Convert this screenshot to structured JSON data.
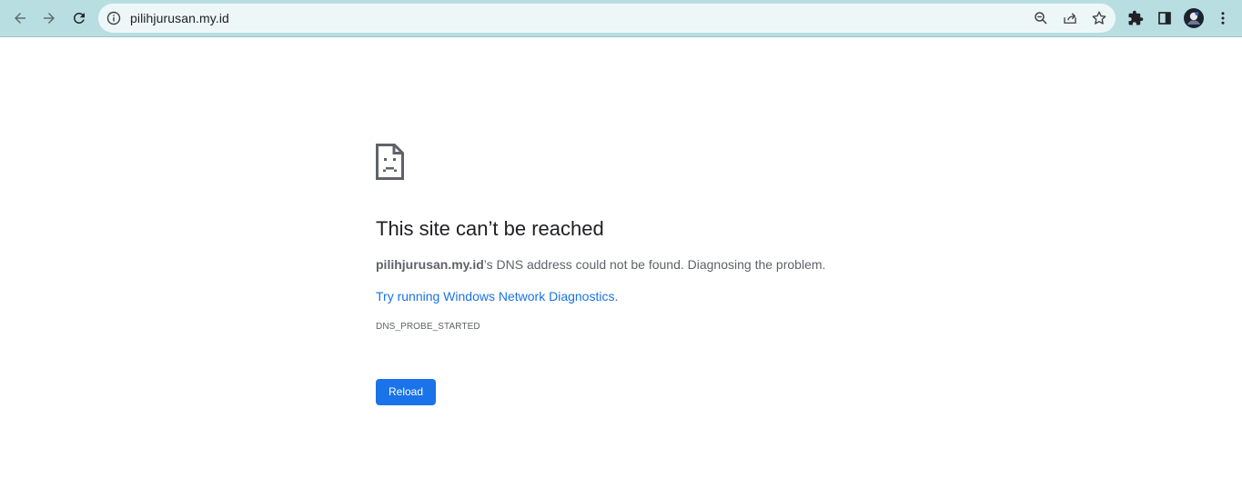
{
  "browser": {
    "url": "pilihjurusan.my.id",
    "colors": {
      "toolbar": "#b8dee2",
      "omnibox": "#eef7f7"
    },
    "icons": [
      "back-arrow-icon",
      "forward-arrow-icon",
      "reload-icon",
      "site-info-icon",
      "zoom-icon",
      "share-icon",
      "bookmark-star-icon",
      "extensions-puzzle-icon",
      "side-panel-icon",
      "profile-avatar",
      "more-menu-icon"
    ]
  },
  "error_page": {
    "icon": "sad-page-icon",
    "title": "This site can’t be reached",
    "host": "pilihjurusan.my.id",
    "message_suffix": "’s DNS address could not be found. Diagnosing the problem.",
    "diagnostics_link": "Try running Windows Network Diagnostics.",
    "error_code": "DNS_PROBE_STARTED",
    "reload_label": "Reload",
    "colors": {
      "link": "#1a73e8",
      "button": "#1a73e8",
      "text": "#5f6368",
      "title": "#202124"
    }
  }
}
